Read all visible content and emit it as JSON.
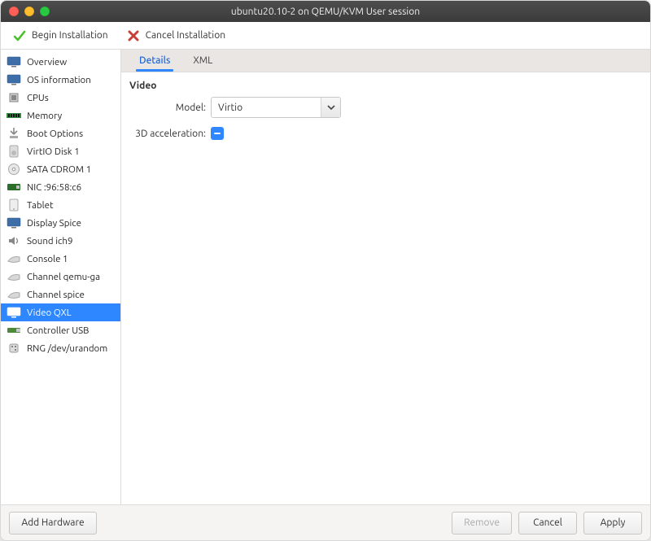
{
  "window": {
    "title": "ubuntu20.10-2 on QEMU/KVM User session"
  },
  "toolbar": {
    "begin_label": "Begin Installation",
    "cancel_label": "Cancel Installation"
  },
  "sidebar": {
    "items": [
      {
        "label": "Overview",
        "icon": "monitor",
        "selected": false
      },
      {
        "label": "OS information",
        "icon": "monitor",
        "selected": false
      },
      {
        "label": "CPUs",
        "icon": "cpu",
        "selected": false
      },
      {
        "label": "Memory",
        "icon": "ram",
        "selected": false
      },
      {
        "label": "Boot Options",
        "icon": "boot",
        "selected": false
      },
      {
        "label": "VirtIO Disk 1",
        "icon": "disk",
        "selected": false
      },
      {
        "label": "SATA CDROM 1",
        "icon": "cdrom",
        "selected": false
      },
      {
        "label": "NIC :96:58:c6",
        "icon": "nic",
        "selected": false
      },
      {
        "label": "Tablet",
        "icon": "tablet",
        "selected": false
      },
      {
        "label": "Display Spice",
        "icon": "display",
        "selected": false
      },
      {
        "label": "Sound ich9",
        "icon": "sound",
        "selected": false
      },
      {
        "label": "Console 1",
        "icon": "console",
        "selected": false
      },
      {
        "label": "Channel qemu-ga",
        "icon": "channel",
        "selected": false
      },
      {
        "label": "Channel spice",
        "icon": "channel",
        "selected": false
      },
      {
        "label": "Video QXL",
        "icon": "video",
        "selected": true
      },
      {
        "label": "Controller USB",
        "icon": "usb",
        "selected": false
      },
      {
        "label": "RNG /dev/urandom",
        "icon": "rng",
        "selected": false
      }
    ]
  },
  "tabs": [
    {
      "label": "Details",
      "active": true
    },
    {
      "label": "XML",
      "active": false
    }
  ],
  "details": {
    "section_title": "Video",
    "model_label": "Model:",
    "model_value": "Virtio",
    "accel_label": "3D acceleration:",
    "accel_checked": true
  },
  "footer": {
    "add_hardware": "Add Hardware",
    "remove": "Remove",
    "cancel": "Cancel",
    "apply": "Apply"
  }
}
